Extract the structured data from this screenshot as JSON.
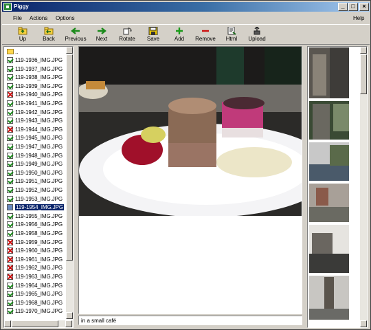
{
  "window": {
    "title": "Piggy",
    "help_label": "Help"
  },
  "menu": {
    "items": [
      "File",
      "Actions",
      "Options"
    ]
  },
  "toolbar": {
    "buttons": [
      {
        "label": "Up",
        "icon": "up-folder-icon"
      },
      {
        "label": "Back",
        "icon": "back-folder-icon"
      },
      {
        "label": "Previous",
        "icon": "arrow-left-icon"
      },
      {
        "label": "Next",
        "icon": "arrow-right-icon"
      },
      {
        "label": "Rotate",
        "icon": "rotate-icon"
      },
      {
        "label": "Save",
        "icon": "save-icon"
      },
      {
        "label": "Add",
        "icon": "plus-icon"
      },
      {
        "label": "Remove",
        "icon": "minus-icon"
      },
      {
        "label": "Html",
        "icon": "html-page-icon"
      },
      {
        "label": "Upload",
        "icon": "upload-icon"
      }
    ]
  },
  "files": {
    "parent": "..",
    "items": [
      {
        "name": "119-1936_IMG.JPG",
        "state": "ok"
      },
      {
        "name": "119-1937_IMG.JPG",
        "state": "ok"
      },
      {
        "name": "119-1938_IMG.JPG",
        "state": "ok"
      },
      {
        "name": "119-1939_IMG.JPG",
        "state": "ok"
      },
      {
        "name": "119-1940_IMG.JPG",
        "state": "no"
      },
      {
        "name": "119-1941_IMG.JPG",
        "state": "ok"
      },
      {
        "name": "119-1942_IMG.JPG",
        "state": "ok"
      },
      {
        "name": "119-1943_IMG.JPG",
        "state": "ok"
      },
      {
        "name": "119-1944_IMG.JPG",
        "state": "no"
      },
      {
        "name": "119-1945_IMG.JPG",
        "state": "ok"
      },
      {
        "name": "119-1947_IMG.JPG",
        "state": "ok"
      },
      {
        "name": "119-1948_IMG.JPG",
        "state": "ok"
      },
      {
        "name": "119-1949_IMG.JPG",
        "state": "ok"
      },
      {
        "name": "119-1950_IMG.JPG",
        "state": "ok"
      },
      {
        "name": "119-1951_IMG.JPG",
        "state": "ok"
      },
      {
        "name": "119-1952_IMG.JPG",
        "state": "ok"
      },
      {
        "name": "119-1953_IMG.JPG",
        "state": "ok"
      },
      {
        "name": "119-1954_IMG.JPG",
        "state": "sel"
      },
      {
        "name": "119-1955_IMG.JPG",
        "state": "ok"
      },
      {
        "name": "119-1956_IMG.JPG",
        "state": "ok"
      },
      {
        "name": "119-1958_IMG.JPG",
        "state": "ok"
      },
      {
        "name": "119-1959_IMG.JPG",
        "state": "no"
      },
      {
        "name": "119-1960_IMG.JPG",
        "state": "no"
      },
      {
        "name": "119-1961_IMG.JPG",
        "state": "no"
      },
      {
        "name": "119-1962_IMG.JPG",
        "state": "no"
      },
      {
        "name": "119-1963_IMG.JPG",
        "state": "no"
      },
      {
        "name": "119-1964_IMG.JPG",
        "state": "ok"
      },
      {
        "name": "119-1965_IMG.JPG",
        "state": "ok"
      },
      {
        "name": "119-1968_IMG.JPG",
        "state": "ok"
      },
      {
        "name": "119-1970_IMG.JPG",
        "state": "ok"
      }
    ]
  },
  "caption": {
    "value": "in a small café"
  },
  "colors": {
    "ok": "#1a8a1a",
    "no": "#cc0000",
    "selection": "#0a246a"
  }
}
